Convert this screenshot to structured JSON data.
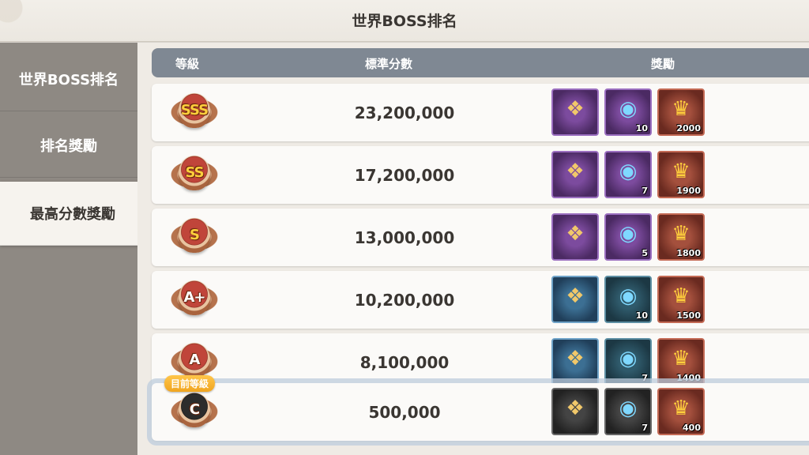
{
  "window": {
    "title": "世界BOSS排名"
  },
  "sidebar": {
    "items": [
      {
        "label": "世界BOSS排名",
        "active": false
      },
      {
        "label": "排名獎勵",
        "active": false
      },
      {
        "label": "最高分數獎勵",
        "active": true
      }
    ]
  },
  "table": {
    "headers": {
      "rank": "等級",
      "score": "標準分數",
      "reward": "獎勵"
    },
    "current_badge": "目前等級",
    "rows": [
      {
        "grade": "SSS",
        "score": "23,200,000",
        "rewards": [
          {
            "icon": "mystery-box-icon",
            "style": "purple",
            "count": ""
          },
          {
            "icon": "crystal-orb-icon",
            "style": "purple",
            "count": "10"
          },
          {
            "icon": "gold-crest-icon",
            "style": "red",
            "count": "2000"
          }
        ]
      },
      {
        "grade": "SS",
        "score": "17,200,000",
        "rewards": [
          {
            "icon": "mystery-box-icon",
            "style": "purple",
            "count": ""
          },
          {
            "icon": "crystal-orb-icon",
            "style": "purple",
            "count": "7"
          },
          {
            "icon": "gold-crest-icon",
            "style": "red",
            "count": "1900"
          }
        ]
      },
      {
        "grade": "S",
        "score": "13,000,000",
        "rewards": [
          {
            "icon": "mystery-box-icon",
            "style": "purple",
            "count": ""
          },
          {
            "icon": "crystal-orb-icon",
            "style": "purple",
            "count": "5"
          },
          {
            "icon": "gold-crest-icon",
            "style": "red",
            "count": "1800"
          }
        ]
      },
      {
        "grade": "A+",
        "score": "10,200,000",
        "rewards": [
          {
            "icon": "mystery-box-icon",
            "style": "blue",
            "count": ""
          },
          {
            "icon": "crystal-orb-icon",
            "style": "teal",
            "count": "10"
          },
          {
            "icon": "gold-crest-icon",
            "style": "red",
            "count": "1500"
          }
        ]
      },
      {
        "grade": "A",
        "score": "8,100,000",
        "rewards": [
          {
            "icon": "mystery-box-icon",
            "style": "blue",
            "count": ""
          },
          {
            "icon": "crystal-orb-icon",
            "style": "teal",
            "count": "7"
          },
          {
            "icon": "gold-crest-icon",
            "style": "red",
            "count": "1400"
          }
        ]
      },
      {
        "grade": "C",
        "score": "500,000",
        "current": true,
        "rewards": [
          {
            "icon": "mystery-box-icon",
            "style": "dark",
            "count": ""
          },
          {
            "icon": "crystal-orb-icon",
            "style": "dark",
            "count": "7"
          },
          {
            "icon": "gold-crest-icon",
            "style": "red",
            "count": "400"
          }
        ]
      }
    ]
  }
}
